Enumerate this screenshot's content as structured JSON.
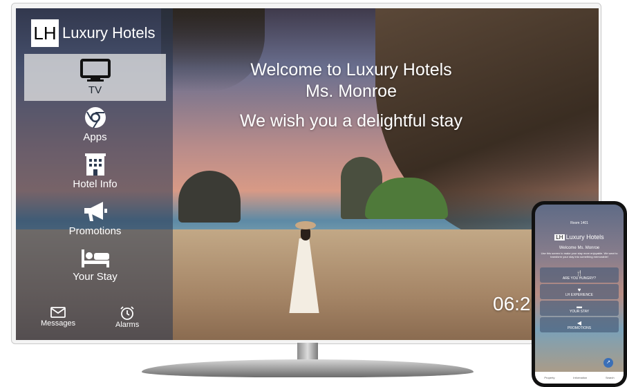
{
  "logo": {
    "mark": "LH",
    "name": "Luxury Hotels"
  },
  "sidebar": {
    "items": [
      {
        "label": "TV",
        "icon": "tv-icon",
        "active": true
      },
      {
        "label": "Apps",
        "icon": "chrome-icon",
        "active": false
      },
      {
        "label": "Hotel Info",
        "icon": "building-icon",
        "active": false
      },
      {
        "label": "Promotions",
        "icon": "megaphone-icon",
        "active": false
      },
      {
        "label": "Your Stay",
        "icon": "bed-icon",
        "active": false
      }
    ],
    "bottom": [
      {
        "label": "Messages",
        "icon": "envelope-icon"
      },
      {
        "label": "Alarms",
        "icon": "alarm-clock-icon"
      }
    ]
  },
  "welcome": {
    "line1": "Welcome to Luxury Hotels",
    "line2": "Ms. Monroe",
    "tagline": "We wish you a delightful stay"
  },
  "clock": "06:2",
  "phone": {
    "room": "Room 1401",
    "logo_mark": "LH",
    "logo_name": "Luxury Hotels",
    "welcome": "Welcome Ms. Monroe",
    "subtext": "Use this screen to make your stay more enjoyable. We want to transform your stay into something memorable!",
    "buttons": [
      {
        "label": "ARE YOU HUNGRY?",
        "icon": "fork-knife-icon"
      },
      {
        "label": "LH EXPERIENCE",
        "icon": "heart-icon"
      },
      {
        "label": "YOUR STAY",
        "icon": "bed-icon"
      },
      {
        "label": "PROMOTIONS",
        "icon": "megaphone-icon"
      }
    ],
    "nav": [
      "Property",
      "Information",
      "Search"
    ]
  },
  "colors": {
    "sidebar_overlay": "#28374f",
    "active_item": "#e1e1e1",
    "accent_blue": "#3b6fb7"
  }
}
